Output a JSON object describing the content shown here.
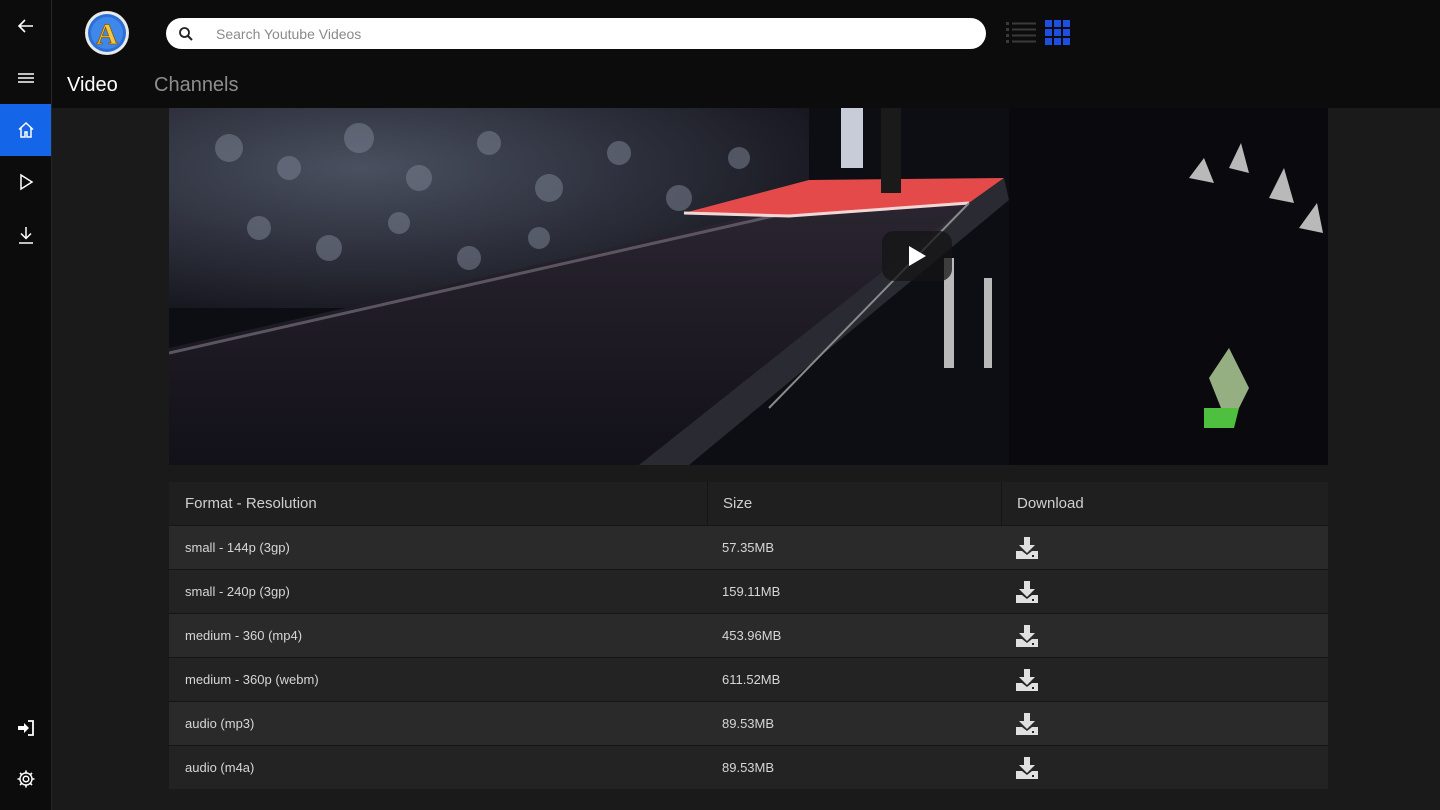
{
  "header": {
    "logo_letter": "A",
    "search": {
      "placeholder": "Search Youtube Videos",
      "value": ""
    },
    "tabs": [
      {
        "label": "Video",
        "active": true
      },
      {
        "label": "Channels",
        "active": false
      }
    ]
  },
  "rail": {
    "items": [
      {
        "icon": "back-arrow-icon"
      },
      {
        "icon": "menu-icon"
      },
      {
        "icon": "home-icon",
        "active": true
      },
      {
        "icon": "play-icon"
      },
      {
        "icon": "download-icon"
      },
      {
        "icon": "sign-in-icon"
      },
      {
        "icon": "gear-icon"
      }
    ]
  },
  "video": {
    "icon": "play-icon"
  },
  "table": {
    "headers": [
      "Format - Resolution",
      "Size",
      "Download"
    ],
    "rows": [
      {
        "format": "small - 144p (3gp)",
        "size": "57.35MB"
      },
      {
        "format": "small - 240p (3gp)",
        "size": "159.11MB"
      },
      {
        "format": "medium - 360 (mp4)",
        "size": "453.96MB"
      },
      {
        "format": "medium - 360p (webm)",
        "size": "611.52MB"
      },
      {
        "format": "audio (mp3)",
        "size": "89.53MB"
      },
      {
        "format": "audio (m4a)",
        "size": "89.53MB"
      }
    ]
  },
  "colors": {
    "accent": "#1565e8",
    "grid_icon": "#1f4fe0",
    "background": "#1a1a1a"
  }
}
